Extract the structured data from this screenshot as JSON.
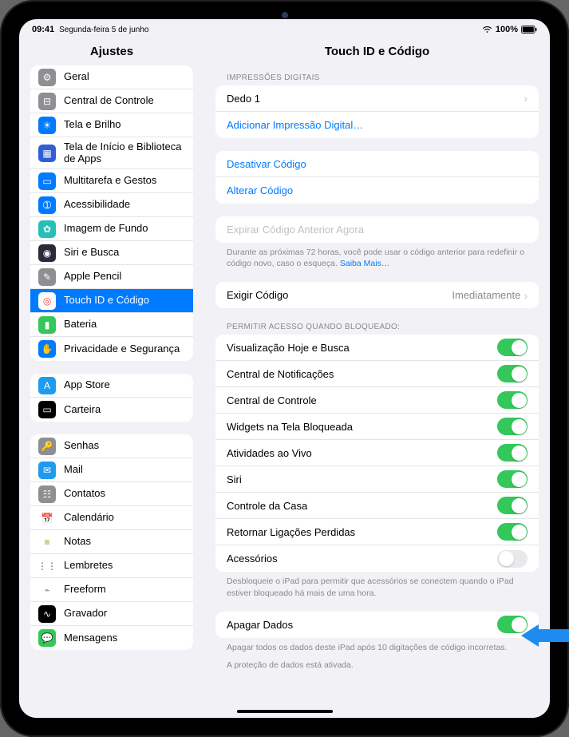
{
  "status": {
    "time": "09:41",
    "date": "Segunda-feira 5 de junho",
    "battery": "100%"
  },
  "header": {
    "left": "Ajustes",
    "right": "Touch ID e Código"
  },
  "sidebar": {
    "g1": [
      {
        "label": "Geral",
        "bg": "#8e8e93",
        "glyph": "⚙︎"
      },
      {
        "label": "Central de Controle",
        "bg": "#8e8e93",
        "glyph": "⊟"
      },
      {
        "label": "Tela e Brilho",
        "bg": "#007aff",
        "glyph": "☀"
      },
      {
        "label": "Tela de Início e Biblioteca de Apps",
        "bg": "#2f5fd8",
        "glyph": "▦",
        "tall": true
      },
      {
        "label": "Multitarefa e Gestos",
        "bg": "#007aff",
        "glyph": "▭"
      },
      {
        "label": "Acessibilidade",
        "bg": "#007aff",
        "glyph": "➀"
      },
      {
        "label": "Imagem de Fundo",
        "bg": "#27beb6",
        "glyph": "✿"
      },
      {
        "label": "Siri e Busca",
        "bg": "#2a2a3b",
        "glyph": "◉"
      },
      {
        "label": "Apple Pencil",
        "bg": "#8e8e93",
        "glyph": "✎"
      },
      {
        "label": "Touch ID e Código",
        "bg": "#ffffff",
        "glyph": "◎",
        "selected": true,
        "glyphColor": "#ff3b30"
      },
      {
        "label": "Bateria",
        "bg": "#34c759",
        "glyph": "▮"
      },
      {
        "label": "Privacidade e Segurança",
        "bg": "#007aff",
        "glyph": "✋"
      }
    ],
    "g2": [
      {
        "label": "App Store",
        "bg": "#1d9bf0",
        "glyph": "A"
      },
      {
        "label": "Carteira",
        "bg": "#000000",
        "glyph": "▭"
      }
    ],
    "g3": [
      {
        "label": "Senhas",
        "bg": "#8e8e93",
        "glyph": "🔑"
      },
      {
        "label": "Mail",
        "bg": "#1d9bf0",
        "glyph": "✉"
      },
      {
        "label": "Contatos",
        "bg": "#8e8e93",
        "glyph": "☷"
      },
      {
        "label": "Calendário",
        "bg": "#ffffff",
        "glyph": "📅",
        "glyphColor": "#ff3b30"
      },
      {
        "label": "Notas",
        "bg": "#ffffff",
        "glyph": "≡",
        "glyphColor": "#b08828"
      },
      {
        "label": "Lembretes",
        "bg": "#ffffff",
        "glyph": "⋮⋮",
        "glyphColor": "#555"
      },
      {
        "label": "Freeform",
        "bg": "#ffffff",
        "glyph": "⌁",
        "glyphColor": "#888"
      },
      {
        "label": "Gravador",
        "bg": "#000000",
        "glyph": "∿"
      },
      {
        "label": "Mensagens",
        "bg": "#34c759",
        "glyph": "💬"
      }
    ]
  },
  "detail": {
    "fingerprints_header": "IMPRESSÕES DIGITAIS",
    "fingerprint1": "Dedo 1",
    "add_fingerprint": "Adicionar Impressão Digital…",
    "turn_off": "Desativar Código",
    "change": "Alterar Código",
    "expire": "Expirar Código Anterior Agora",
    "expire_note_a": "Durante as próximas 72 horas, você pode usar o código anterior para redefinir o código novo, caso o esqueça. ",
    "expire_note_link": "Saiba Mais…",
    "require_label": "Exigir Código",
    "require_value": "Imediatamente",
    "locked_header": "PERMITIR ACESSO QUANDO BLOQUEADO:",
    "locked": [
      {
        "label": "Visualização Hoje e Busca",
        "on": true
      },
      {
        "label": "Central de Notificações",
        "on": true
      },
      {
        "label": "Central de Controle",
        "on": true
      },
      {
        "label": "Widgets na Tela Bloqueada",
        "on": true
      },
      {
        "label": "Atividades ao Vivo",
        "on": true
      },
      {
        "label": "Siri",
        "on": true
      },
      {
        "label": "Controle da Casa",
        "on": true
      },
      {
        "label": "Retornar Ligações Perdidas",
        "on": true
      },
      {
        "label": "Acessórios",
        "on": false
      }
    ],
    "locked_note": "Desbloqueie o iPad para permitir que acessórios se conectem quando o iPad estiver bloqueado há mais de uma hora.",
    "erase_label": "Apagar Dados",
    "erase_on": true,
    "erase_note1": "Apagar todos os dados deste iPad após 10 digitações de código incorretas.",
    "erase_note2": "A proteção de dados está ativada."
  }
}
